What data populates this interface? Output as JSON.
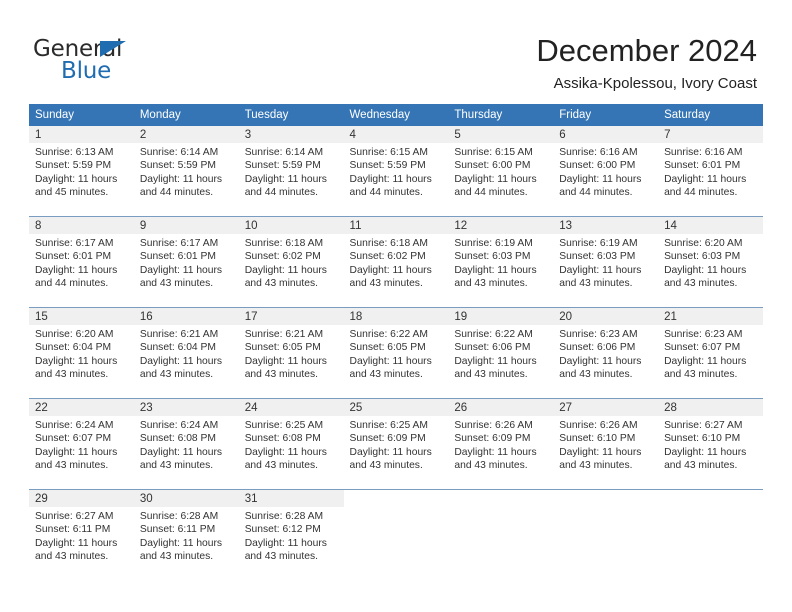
{
  "brand": {
    "name_part1": "General",
    "name_part2": "Blue",
    "accent_color": "#1f6cb0"
  },
  "header": {
    "title": "December 2024",
    "subtitle": "Assika-Kpolessou, Ivory Coast"
  },
  "colors": {
    "header_blue": "#3575b5",
    "daynum_band": "#f0f0f0",
    "week_divider": "#7a9cc0",
    "text": "#333333"
  },
  "calendar": {
    "weekday_headers": [
      "Sunday",
      "Monday",
      "Tuesday",
      "Wednesday",
      "Thursday",
      "Friday",
      "Saturday"
    ],
    "weeks": [
      [
        {
          "day": "1",
          "sunrise": "Sunrise: 6:13 AM",
          "sunset": "Sunset: 5:59 PM",
          "daylight_line1": "Daylight: 11 hours",
          "daylight_line2": "and 45 minutes."
        },
        {
          "day": "2",
          "sunrise": "Sunrise: 6:14 AM",
          "sunset": "Sunset: 5:59 PM",
          "daylight_line1": "Daylight: 11 hours",
          "daylight_line2": "and 44 minutes."
        },
        {
          "day": "3",
          "sunrise": "Sunrise: 6:14 AM",
          "sunset": "Sunset: 5:59 PM",
          "daylight_line1": "Daylight: 11 hours",
          "daylight_line2": "and 44 minutes."
        },
        {
          "day": "4",
          "sunrise": "Sunrise: 6:15 AM",
          "sunset": "Sunset: 5:59 PM",
          "daylight_line1": "Daylight: 11 hours",
          "daylight_line2": "and 44 minutes."
        },
        {
          "day": "5",
          "sunrise": "Sunrise: 6:15 AM",
          "sunset": "Sunset: 6:00 PM",
          "daylight_line1": "Daylight: 11 hours",
          "daylight_line2": "and 44 minutes."
        },
        {
          "day": "6",
          "sunrise": "Sunrise: 6:16 AM",
          "sunset": "Sunset: 6:00 PM",
          "daylight_line1": "Daylight: 11 hours",
          "daylight_line2": "and 44 minutes."
        },
        {
          "day": "7",
          "sunrise": "Sunrise: 6:16 AM",
          "sunset": "Sunset: 6:01 PM",
          "daylight_line1": "Daylight: 11 hours",
          "daylight_line2": "and 44 minutes."
        }
      ],
      [
        {
          "day": "8",
          "sunrise": "Sunrise: 6:17 AM",
          "sunset": "Sunset: 6:01 PM",
          "daylight_line1": "Daylight: 11 hours",
          "daylight_line2": "and 44 minutes."
        },
        {
          "day": "9",
          "sunrise": "Sunrise: 6:17 AM",
          "sunset": "Sunset: 6:01 PM",
          "daylight_line1": "Daylight: 11 hours",
          "daylight_line2": "and 43 minutes."
        },
        {
          "day": "10",
          "sunrise": "Sunrise: 6:18 AM",
          "sunset": "Sunset: 6:02 PM",
          "daylight_line1": "Daylight: 11 hours",
          "daylight_line2": "and 43 minutes."
        },
        {
          "day": "11",
          "sunrise": "Sunrise: 6:18 AM",
          "sunset": "Sunset: 6:02 PM",
          "daylight_line1": "Daylight: 11 hours",
          "daylight_line2": "and 43 minutes."
        },
        {
          "day": "12",
          "sunrise": "Sunrise: 6:19 AM",
          "sunset": "Sunset: 6:03 PM",
          "daylight_line1": "Daylight: 11 hours",
          "daylight_line2": "and 43 minutes."
        },
        {
          "day": "13",
          "sunrise": "Sunrise: 6:19 AM",
          "sunset": "Sunset: 6:03 PM",
          "daylight_line1": "Daylight: 11 hours",
          "daylight_line2": "and 43 minutes."
        },
        {
          "day": "14",
          "sunrise": "Sunrise: 6:20 AM",
          "sunset": "Sunset: 6:03 PM",
          "daylight_line1": "Daylight: 11 hours",
          "daylight_line2": "and 43 minutes."
        }
      ],
      [
        {
          "day": "15",
          "sunrise": "Sunrise: 6:20 AM",
          "sunset": "Sunset: 6:04 PM",
          "daylight_line1": "Daylight: 11 hours",
          "daylight_line2": "and 43 minutes."
        },
        {
          "day": "16",
          "sunrise": "Sunrise: 6:21 AM",
          "sunset": "Sunset: 6:04 PM",
          "daylight_line1": "Daylight: 11 hours",
          "daylight_line2": "and 43 minutes."
        },
        {
          "day": "17",
          "sunrise": "Sunrise: 6:21 AM",
          "sunset": "Sunset: 6:05 PM",
          "daylight_line1": "Daylight: 11 hours",
          "daylight_line2": "and 43 minutes."
        },
        {
          "day": "18",
          "sunrise": "Sunrise: 6:22 AM",
          "sunset": "Sunset: 6:05 PM",
          "daylight_line1": "Daylight: 11 hours",
          "daylight_line2": "and 43 minutes."
        },
        {
          "day": "19",
          "sunrise": "Sunrise: 6:22 AM",
          "sunset": "Sunset: 6:06 PM",
          "daylight_line1": "Daylight: 11 hours",
          "daylight_line2": "and 43 minutes."
        },
        {
          "day": "20",
          "sunrise": "Sunrise: 6:23 AM",
          "sunset": "Sunset: 6:06 PM",
          "daylight_line1": "Daylight: 11 hours",
          "daylight_line2": "and 43 minutes."
        },
        {
          "day": "21",
          "sunrise": "Sunrise: 6:23 AM",
          "sunset": "Sunset: 6:07 PM",
          "daylight_line1": "Daylight: 11 hours",
          "daylight_line2": "and 43 minutes."
        }
      ],
      [
        {
          "day": "22",
          "sunrise": "Sunrise: 6:24 AM",
          "sunset": "Sunset: 6:07 PM",
          "daylight_line1": "Daylight: 11 hours",
          "daylight_line2": "and 43 minutes."
        },
        {
          "day": "23",
          "sunrise": "Sunrise: 6:24 AM",
          "sunset": "Sunset: 6:08 PM",
          "daylight_line1": "Daylight: 11 hours",
          "daylight_line2": "and 43 minutes."
        },
        {
          "day": "24",
          "sunrise": "Sunrise: 6:25 AM",
          "sunset": "Sunset: 6:08 PM",
          "daylight_line1": "Daylight: 11 hours",
          "daylight_line2": "and 43 minutes."
        },
        {
          "day": "25",
          "sunrise": "Sunrise: 6:25 AM",
          "sunset": "Sunset: 6:09 PM",
          "daylight_line1": "Daylight: 11 hours",
          "daylight_line2": "and 43 minutes."
        },
        {
          "day": "26",
          "sunrise": "Sunrise: 6:26 AM",
          "sunset": "Sunset: 6:09 PM",
          "daylight_line1": "Daylight: 11 hours",
          "daylight_line2": "and 43 minutes."
        },
        {
          "day": "27",
          "sunrise": "Sunrise: 6:26 AM",
          "sunset": "Sunset: 6:10 PM",
          "daylight_line1": "Daylight: 11 hours",
          "daylight_line2": "and 43 minutes."
        },
        {
          "day": "28",
          "sunrise": "Sunrise: 6:27 AM",
          "sunset": "Sunset: 6:10 PM",
          "daylight_line1": "Daylight: 11 hours",
          "daylight_line2": "and 43 minutes."
        }
      ],
      [
        {
          "day": "29",
          "sunrise": "Sunrise: 6:27 AM",
          "sunset": "Sunset: 6:11 PM",
          "daylight_line1": "Daylight: 11 hours",
          "daylight_line2": "and 43 minutes."
        },
        {
          "day": "30",
          "sunrise": "Sunrise: 6:28 AM",
          "sunset": "Sunset: 6:11 PM",
          "daylight_line1": "Daylight: 11 hours",
          "daylight_line2": "and 43 minutes."
        },
        {
          "day": "31",
          "sunrise": "Sunrise: 6:28 AM",
          "sunset": "Sunset: 6:12 PM",
          "daylight_line1": "Daylight: 11 hours",
          "daylight_line2": "and 43 minutes."
        },
        {
          "day": "",
          "sunrise": "",
          "sunset": "",
          "daylight_line1": "",
          "daylight_line2": ""
        },
        {
          "day": "",
          "sunrise": "",
          "sunset": "",
          "daylight_line1": "",
          "daylight_line2": ""
        },
        {
          "day": "",
          "sunrise": "",
          "sunset": "",
          "daylight_line1": "",
          "daylight_line2": ""
        },
        {
          "day": "",
          "sunrise": "",
          "sunset": "",
          "daylight_line1": "",
          "daylight_line2": ""
        }
      ]
    ]
  }
}
